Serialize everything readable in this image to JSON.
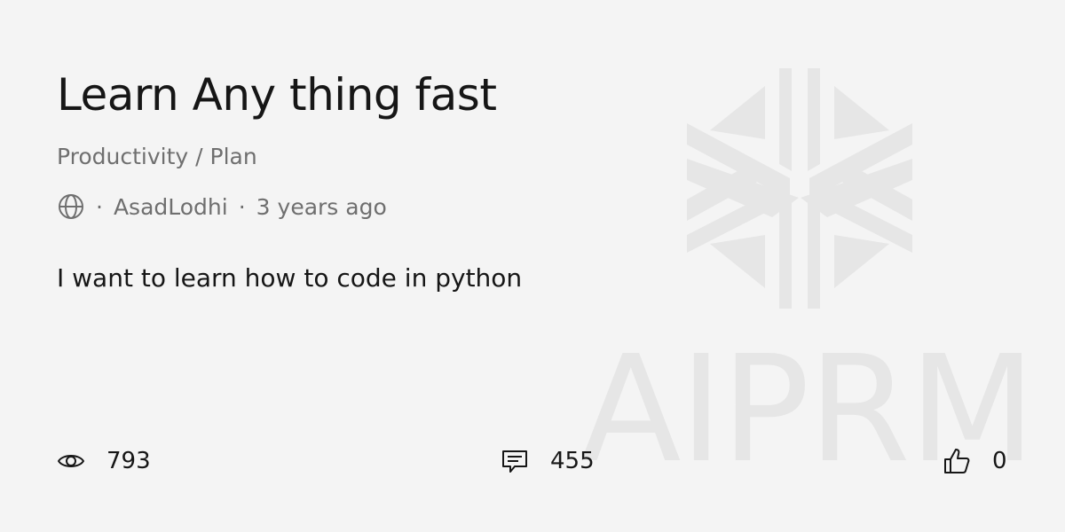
{
  "prompt": {
    "title": "Learn Any thing fast",
    "breadcrumb": "Productivity / Plan",
    "visibility_icon": "globe-icon",
    "separator": "·",
    "author": "AsadLodhi",
    "time_ago": "3 years ago",
    "description": "I want to learn how to code in python"
  },
  "stats": {
    "views": {
      "icon": "eye-icon",
      "count": "793"
    },
    "comments": {
      "icon": "comment-icon",
      "count": "455"
    },
    "likes": {
      "icon": "thumbs-up-icon",
      "count": "0"
    }
  },
  "watermark": {
    "brand_text": "AIPRM",
    "color": "#e6e6e6"
  },
  "colors": {
    "background": "#f4f4f4",
    "text_primary": "#161616",
    "text_secondary": "#6f6f6f"
  }
}
